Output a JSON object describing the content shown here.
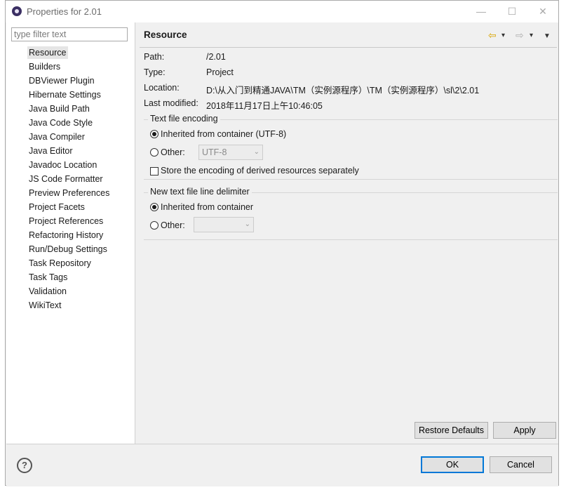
{
  "window": {
    "title": "Properties for 2.01",
    "minimize": "—",
    "maximize": "☐",
    "close": "✕"
  },
  "filter": {
    "placeholder": "type filter text"
  },
  "tree": {
    "items": [
      "Resource",
      "Builders",
      "DBViewer Plugin",
      "Hibernate Settings",
      "Java Build Path",
      "Java Code Style",
      "Java Compiler",
      "Java Editor",
      "Javadoc Location",
      "JS Code Formatter",
      "Preview Preferences",
      "Project Facets",
      "Project References",
      "Refactoring History",
      "Run/Debug Settings",
      "Task Repository",
      "Task Tags",
      "Validation",
      "WikiText"
    ],
    "selected": "Resource"
  },
  "page": {
    "title": "Resource",
    "back_icon": "⇦",
    "forward_icon": "⇨",
    "dropdown_icon": "▾",
    "menu_icon": "▼"
  },
  "properties": {
    "path_label": "Path:",
    "path_value": "/2.01",
    "type_label": "Type:",
    "type_value": "Project",
    "location_label": "Location:",
    "location_value": "D:\\从入门到精通JAVA\\TM（实例源程序）\\TM（实例源程序）\\sl\\2\\2.01",
    "modified_label": "Last modified:",
    "modified_value": "2018年11月17日上午10:46:05"
  },
  "encoding": {
    "group_title": "Text file encoding",
    "inherited_label": "Inherited from container (UTF-8)",
    "other_label": "Other:",
    "other_value": "UTF-8",
    "store_label": "Store the encoding of derived resources separately"
  },
  "delimiter": {
    "group_title": "New text file line delimiter",
    "inherited_label": "Inherited from container",
    "other_label": "Other:",
    "other_value": ""
  },
  "buttons": {
    "restore_defaults": "Restore Defaults",
    "apply": "Apply",
    "ok": "OK",
    "cancel": "Cancel"
  },
  "help": {
    "glyph": "?"
  }
}
